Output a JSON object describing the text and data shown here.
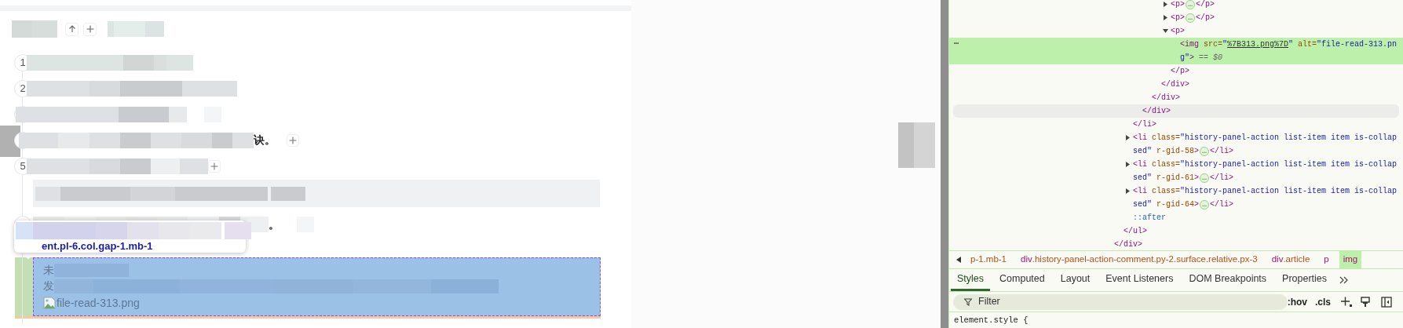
{
  "timeline": [
    {
      "kind": "entry",
      "number": "1"
    },
    {
      "kind": "entry",
      "number": "2"
    },
    {
      "kind": "entry"
    },
    {
      "kind": "entry",
      "text": "诀。"
    },
    {
      "kind": "entry",
      "number": "5"
    },
    {
      "kind": "quote"
    },
    {
      "kind": "entry",
      "text": "。"
    }
  ],
  "inspect_tooltip": {
    "selector": "ent.pl-6.col.gap-1.mb-1"
  },
  "selected_block": {
    "lines": [
      "未",
      "发"
    ],
    "image_alt": "file-read-313.png"
  },
  "devtools": {
    "tree": [
      {
        "selected": false,
        "hovered": false,
        "close": [
          {
            "tag": "</div>"
          }
        ],
        "children": [
          {
            "selected": false,
            "hovered": false,
            "close": [
              {
                "tag": "</ul>"
              }
            ],
            "children": [
              {
                "selected": false,
                "hovered": false,
                "close": [
                  {
                    "tag": "</li>"
                  }
                ],
                "children": [
                  {
                    "selected": false,
                    "hovered": true,
                    "close": [
                      {
                        "tag": "</div>"
                      }
                    ],
                    "children": [
                      {
                        "selected": false,
                        "hovered": false,
                        "close": [
                          {
                            "tag": "</div>"
                          }
                        ],
                        "children": [
                          {
                            "selected": false,
                            "hovered": false,
                            "close": [
                              {
                                "tag": "</div>"
                              }
                            ],
                            "children": [
                              {
                                "selected": false,
                                "hovered": false,
                                "expanded": false,
                                "open": [
                                  {
                                    "tag": "<p>"
                                  }
                                ],
                                "ellipsis": "…",
                                "close": [
                                  {
                                    "tag": "</p>"
                                  }
                                ]
                              },
                              {
                                "selected": false,
                                "hovered": false,
                                "expanded": false,
                                "open": [
                                  {
                                    "tag": "<p>"
                                  }
                                ],
                                "ellipsis": "…",
                                "close": [
                                  {
                                    "tag": "</p>"
                                  }
                                ]
                              },
                              {
                                "selected": false,
                                "hovered": false,
                                "expanded": true,
                                "open": [
                                  {
                                    "tag": "<p>"
                                  }
                                ],
                                "close": [
                                  {
                                    "tag": "</p>"
                                  }
                                ],
                                "children": [
                                  {
                                    "selected": true,
                                    "hovered": false,
                                    "menu": "…",
                                    "open": [
                                      {
                                        "tag": "<img"
                                      },
                                      {
                                        "attr": " src="
                                      },
                                      {
                                        "value": "\""
                                      },
                                      {
                                        "link": "%7B313.png%7D"
                                      },
                                      {
                                        "value": "\""
                                      },
                                      {
                                        "attr": " alt="
                                      },
                                      {
                                        "value": "\"file-read-313.png\""
                                      },
                                      {
                                        "tag": ">"
                                      }
                                    ],
                                    "suffix": " == $0"
                                  }
                                ]
                              }
                            ]
                          }
                        ]
                      }
                    ]
                  }
                ]
              },
              {
                "selected": false,
                "hovered": false,
                "expanded": false,
                "open": [
                  {
                    "tag": "<li"
                  },
                  {
                    "attr": " class="
                  },
                  {
                    "value": "\"history-panel-action list-item item is-collapsed\""
                  },
                  {
                    "attr": " r-gid-58"
                  },
                  {
                    "tag": ">"
                  }
                ],
                "ellipsis": "…",
                "close": [
                  {
                    "tag": "</li>"
                  }
                ]
              },
              {
                "selected": false,
                "hovered": false,
                "expanded": false,
                "open": [
                  {
                    "tag": "<li"
                  },
                  {
                    "attr": " class="
                  },
                  {
                    "value": "\"history-panel-action list-item item is-collapsed\""
                  },
                  {
                    "attr": " r-gid-61"
                  },
                  {
                    "tag": ">"
                  }
                ],
                "ellipsis": "…",
                "close": [
                  {
                    "tag": "</li>"
                  }
                ]
              },
              {
                "selected": false,
                "hovered": false,
                "expanded": false,
                "open": [
                  {
                    "tag": "<li"
                  },
                  {
                    "attr": " class="
                  },
                  {
                    "value": "\"history-panel-action list-item item is-collapsed\""
                  },
                  {
                    "attr": " r-gid-64"
                  },
                  {
                    "tag": ">"
                  }
                ],
                "ellipsis": "…",
                "close": [
                  {
                    "tag": "</li>"
                  }
                ]
              },
              {
                "selected": false,
                "hovered": false,
                "open": [
                  {
                    "pseudo": "::after"
                  }
                ]
              }
            ]
          }
        ]
      }
    ],
    "breadcrumbs": [
      {
        "cls": "p-1.mb-1",
        "selected": false
      },
      {
        "tag": "div",
        "cls": ".history-panel-action-comment.py-2.surface.relative.px-3",
        "selected": false
      },
      {
        "tag": "div",
        "cls": ".article",
        "selected": false
      },
      {
        "tag": "p",
        "selected": false
      },
      {
        "tag": "img",
        "selected": true
      }
    ],
    "tabs": [
      {
        "label": "Styles",
        "selected": true
      },
      {
        "label": "Computed",
        "selected": false
      },
      {
        "label": "Layout",
        "selected": false
      },
      {
        "label": "Event Listeners",
        "selected": false
      },
      {
        "label": "DOM Breakpoints",
        "selected": false
      },
      {
        "label": "Properties",
        "selected": false
      }
    ],
    "filter": {
      "placeholder": "Filter"
    },
    "toolbar": [
      ":hov",
      ".cls"
    ],
    "styles": [
      "element.style {"
    ]
  }
}
